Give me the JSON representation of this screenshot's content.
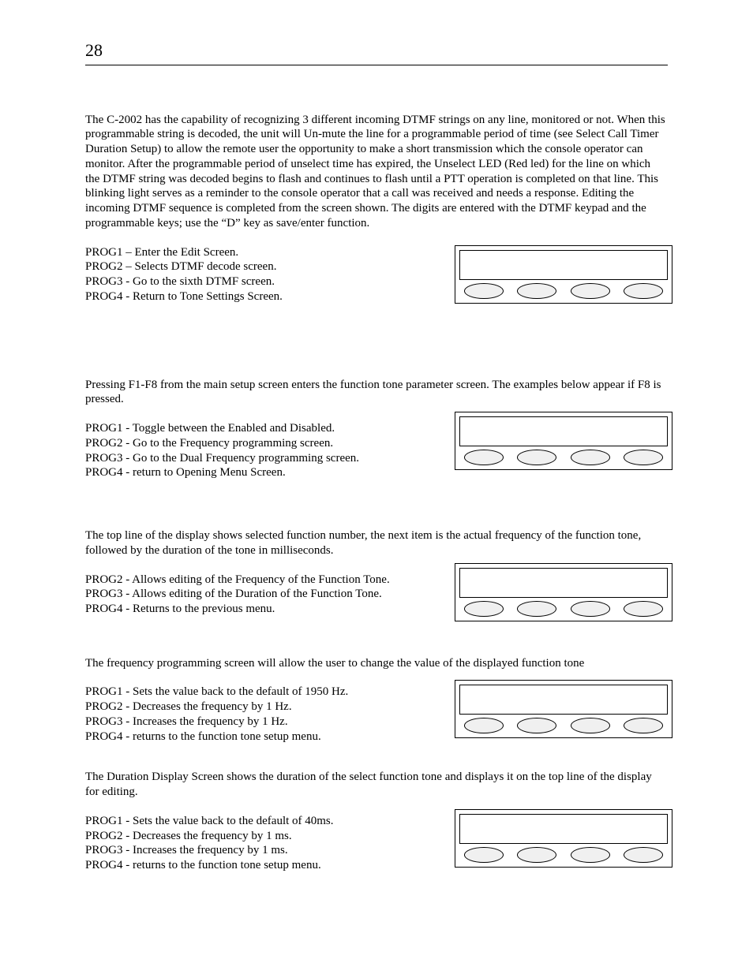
{
  "page": {
    "number": "28"
  },
  "s1": {
    "para": "The C-2002 has the capability of recognizing 3 different incoming DTMF strings on any line, monitored or not.  When this programmable string is decoded, the unit will Un-mute the line for a programmable period of time (see Select Call Timer Duration Setup) to allow the remote user the opportunity to make a short transmission which the console operator can monitor.  After the programmable period of unselect time has expired, the Unselect LED (Red led) for the line on which the DTMF string was decoded begins to flash and continues to flash until a PTT operation is completed on that line.  This blinking light serves as a reminder to the console operator that a call was received and needs a response.  Editing the incoming DTMF sequence is completed from the screen shown.  The digits are entered with the DTMF keypad and the programmable keys; use the “D” key as save/enter function.",
    "p1": "PROG1 – Enter the Edit Screen.",
    "p2": "PROG2 – Selects DTMF decode screen.",
    "p3": "PROG3 - Go to the sixth DTMF screen.",
    "p4": "PROG4 - Return to Tone Settings Screen."
  },
  "s2": {
    "para": "Pressing F1-F8 from the main setup screen enters the function tone parameter screen.  The examples below appear if F8 is pressed.",
    "p1": "PROG1 - Toggle between the Enabled and Disabled.",
    "p2": "PROG2 - Go to the Frequency programming screen.",
    "p3": "PROG3 - Go to the Dual Frequency programming screen.",
    "p4": "PROG4 - return to Opening Menu Screen."
  },
  "s3": {
    "para": "The top line of the display shows selected function number, the next item is the actual frequency of the function tone, followed by the duration of the tone in milliseconds.",
    "p2": "PROG2 - Allows editing of the Frequency of the Function Tone.",
    "p3": "PROG3 - Allows editing of the Duration of the Function Tone.",
    "p4": "PROG4 - Returns to the previous menu."
  },
  "s4": {
    "para": "The frequency programming screen will allow the user to change the value of the displayed function tone",
    "p1": "PROG1 - Sets the value back to the default of 1950 Hz.",
    "p2": "PROG2 - Decreases the frequency by 1 Hz.",
    "p3": "PROG3 - Increases the frequency by 1 Hz.",
    "p4": "PROG4 - returns to the function tone setup menu."
  },
  "s5": {
    "para": "The Duration Display Screen shows the duration of the select function tone and displays it on the top line of the display for editing.",
    "p1": "PROG1 - Sets the value back to the default of 40ms.",
    "p2": "PROG2 - Decreases the frequency by 1 ms.",
    "p3": "PROG3 - Increases the frequency by 1 ms.",
    "p4": "PROG4 - returns to the function tone setup menu."
  }
}
